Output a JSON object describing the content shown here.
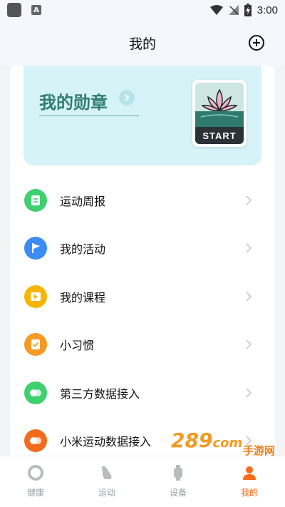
{
  "status_bar": {
    "time": "3:00"
  },
  "header": {
    "title": "我的"
  },
  "medal": {
    "title": "我的勋章",
    "badge_text": "START"
  },
  "menu": [
    {
      "label": "运动周报",
      "icon": "report-icon",
      "color": "#3ecf6e"
    },
    {
      "label": "我的活动",
      "icon": "flag-icon",
      "color": "#3b8cf5"
    },
    {
      "label": "我的课程",
      "icon": "play-icon",
      "color": "#f7b500"
    },
    {
      "label": "小习惯",
      "icon": "habit-check-icon",
      "color": "#f59a23"
    },
    {
      "label": "第三方数据接入",
      "icon": "link-icon",
      "color": "#3ecf6e"
    },
    {
      "label": "小米运动数据接入",
      "icon": "mi-link-icon",
      "color": "#f26b1d"
    }
  ],
  "bottom_nav": [
    {
      "label": "健康",
      "icon": "health-ring-icon",
      "active": false
    },
    {
      "label": "运动",
      "icon": "shoe-icon",
      "active": false
    },
    {
      "label": "设备",
      "icon": "watch-icon",
      "active": false
    },
    {
      "label": "我的",
      "icon": "profile-icon",
      "active": true
    }
  ],
  "watermark": {
    "main": "289",
    "suffix": "com",
    "sub": "手游网"
  },
  "colors": {
    "accent": "#ff6a1a",
    "medal_bg": "#d6f3f8",
    "medal_title": "#2f7d70"
  }
}
